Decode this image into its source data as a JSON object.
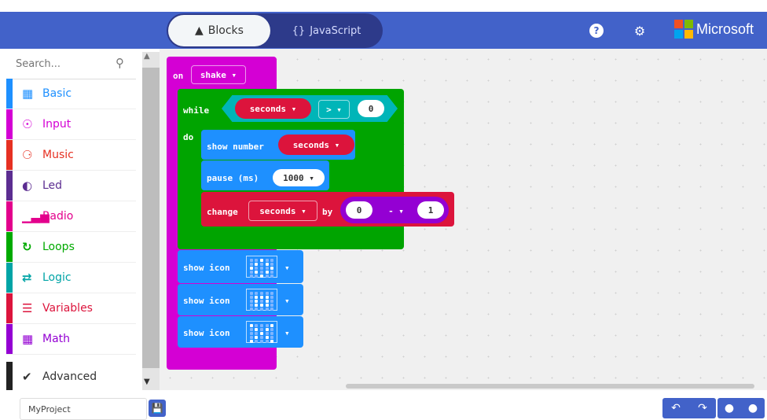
{
  "header": {
    "tab_blocks": "Blocks",
    "tab_javascript": "JavaScript",
    "brand": "Microsoft",
    "colors": {
      "bar": "#4262c9"
    }
  },
  "toolbox": {
    "search_placeholder": "Search...",
    "categories": [
      {
        "label": "Basic",
        "icon": "grid-icon",
        "color": "#1e90ff"
      },
      {
        "label": "Input",
        "icon": "target-icon",
        "color": "#d400d4"
      },
      {
        "label": "Music",
        "icon": "headphones-icon",
        "color": "#e63022"
      },
      {
        "label": "Led",
        "icon": "toggle-icon",
        "color": "#5c2d91"
      },
      {
        "label": "Radio",
        "icon": "signal-icon",
        "color": "#e3008c"
      },
      {
        "label": "Loops",
        "icon": "refresh-icon",
        "color": "#00aa00"
      },
      {
        "label": "Logic",
        "icon": "shuffle-icon",
        "color": "#00a4a6"
      },
      {
        "label": "Variables",
        "icon": "list-icon",
        "color": "#dc143c"
      },
      {
        "label": "Math",
        "icon": "calculator-icon",
        "color": "#9400d3"
      }
    ],
    "advanced": "Advanced"
  },
  "blocks": {
    "on_label": "on",
    "event_value": "shake ▾",
    "while_label": "while",
    "do_label": "do",
    "cond_var": "seconds ▾",
    "cond_op": "> ▾",
    "cond_value": "0",
    "show_number_label": "show number",
    "show_number_var": "seconds ▾",
    "pause_label": "pause (ms)",
    "pause_value": "1000 ▾",
    "change_label": "change",
    "change_var": "seconds ▾",
    "by_label": "by",
    "math_left": "0",
    "math_op": "- ▾",
    "math_right": "1",
    "show_icon_label": "show icon",
    "dropdown_arrow": "▾"
  },
  "footer": {
    "project_name": "MyProject"
  }
}
